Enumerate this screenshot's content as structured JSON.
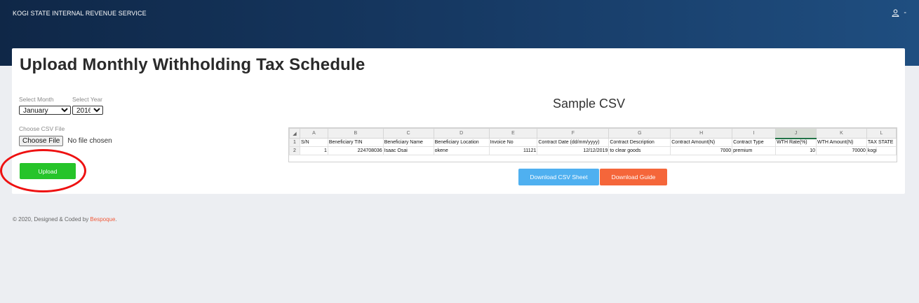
{
  "header": {
    "brand": "KOGI STATE INTERNAL REVENUE SERVICE",
    "user_name": "-"
  },
  "page": {
    "title": "Upload Monthly Withholding Tax Schedule"
  },
  "form": {
    "month_label": "Select Month",
    "month_value": "January",
    "year_label": "Select Year",
    "year_value": "2016",
    "file_label": "Choose CSV File",
    "choose_file_button": "Choose File",
    "file_status": "No file chosen",
    "upload_button": "Upload"
  },
  "sample": {
    "title": "Sample CSV",
    "column_letters": [
      "A",
      "B",
      "C",
      "D",
      "E",
      "F",
      "G",
      "H",
      "I",
      "J",
      "K",
      "L"
    ],
    "row_numbers": [
      "1",
      "2"
    ],
    "headers": [
      "S/N",
      "Beneficiary TIN",
      "Beneficiary Name",
      "Beneficiary Location",
      "Invoice No",
      "Contract Date (dd/mm/yyyy)",
      "Contract Description",
      "Contract Amount(N)",
      "Contract Type",
      "WTH Rate(%)",
      "WTH Amount(N)",
      "TAX STATE"
    ],
    "row": [
      "1",
      "224708036",
      "Isaac Osai",
      "okene",
      "11121",
      "12/12/2019",
      "to clear goods",
      "7000",
      "premium",
      "10",
      "70000",
      "kogi"
    ],
    "download_csv_button": "Download CSV Sheet",
    "download_guide_button": "Download Guide"
  },
  "footer": {
    "text": "© 2020, Designed & Coded by ",
    "link": "Bespoque",
    "suffix": "."
  },
  "colors": {
    "upload_green": "#26c42a",
    "csv_blue": "#4fb0f0",
    "guide_orange": "#f5663a",
    "annotation_red": "#e11111"
  }
}
